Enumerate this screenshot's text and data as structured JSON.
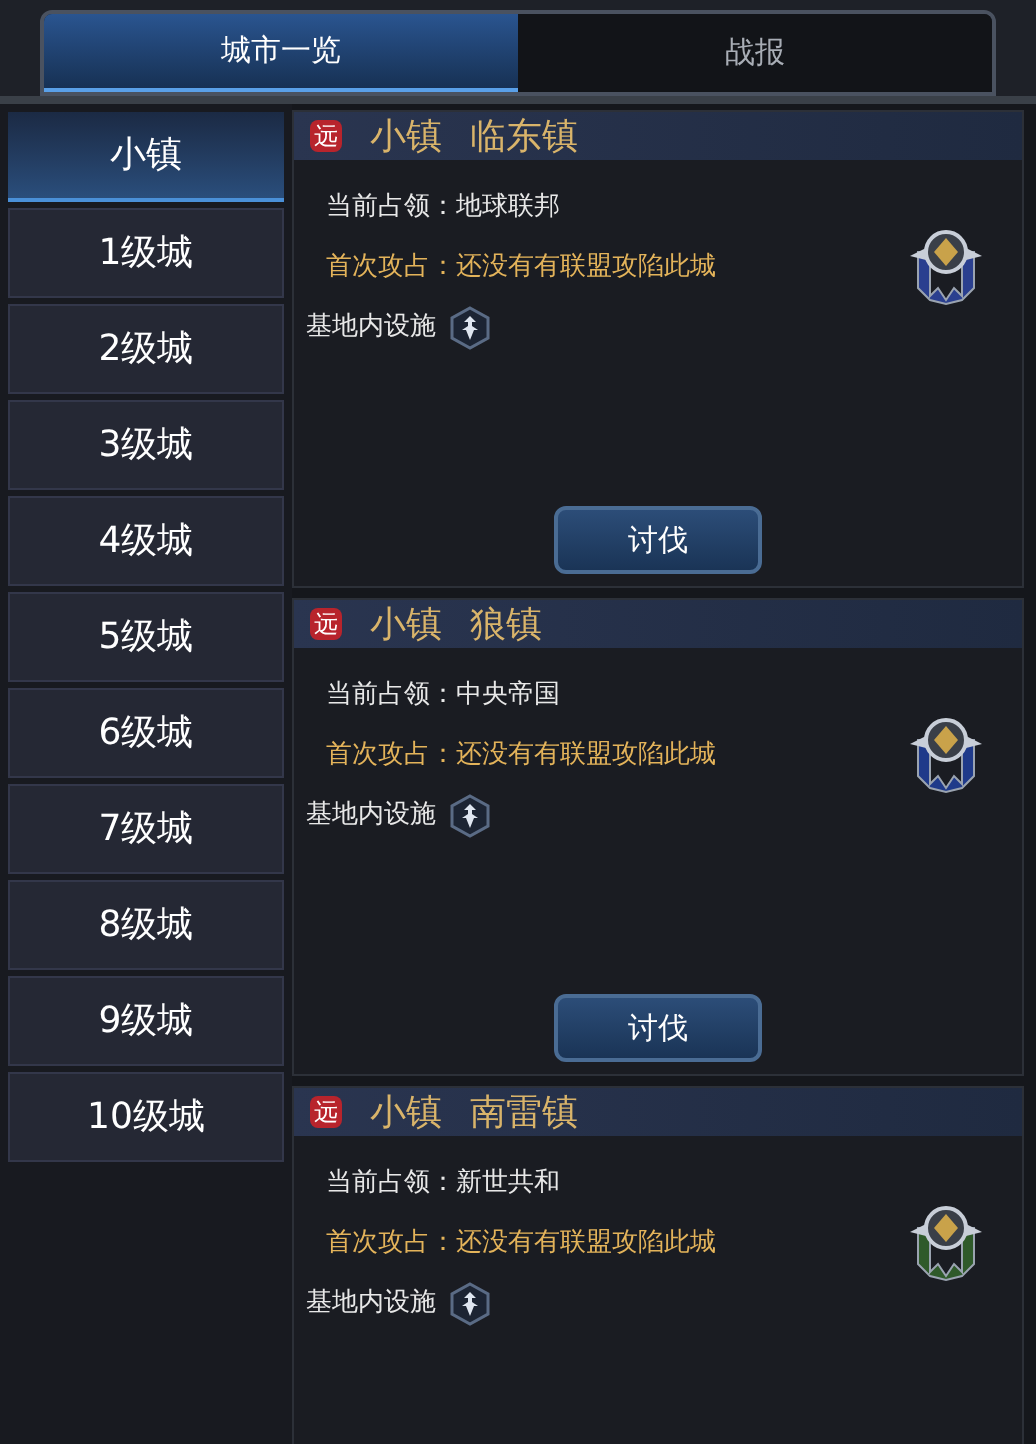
{
  "tabs": [
    {
      "label": "城市一览",
      "selected": true
    },
    {
      "label": "战报",
      "selected": false
    }
  ],
  "sidebar": {
    "items": [
      {
        "label": "小镇",
        "selected": true
      },
      {
        "label": "1级城",
        "selected": false
      },
      {
        "label": "2级城",
        "selected": false
      },
      {
        "label": "3级城",
        "selected": false
      },
      {
        "label": "4级城",
        "selected": false
      },
      {
        "label": "5级城",
        "selected": false
      },
      {
        "label": "6级城",
        "selected": false
      },
      {
        "label": "7级城",
        "selected": false
      },
      {
        "label": "8级城",
        "selected": false
      },
      {
        "label": "9级城",
        "selected": false
      },
      {
        "label": "10级城",
        "selected": false
      }
    ]
  },
  "cities": [
    {
      "badge": "远",
      "type": "小镇",
      "name": "临东镇",
      "occupant_label": "当前占领：",
      "occupant": "地球联邦",
      "first_capture": "首次攻占：还没有有联盟攻陷此城",
      "facilities_label": "基地内设施",
      "color": "#2a3f8f",
      "button": "讨伐"
    },
    {
      "badge": "远",
      "type": "小镇",
      "name": "狼镇",
      "occupant_label": "当前占领：",
      "occupant": "中央帝国",
      "first_capture": "首次攻占：还没有有联盟攻陷此城",
      "facilities_label": "基地内设施",
      "color": "#1f3a8a",
      "button": "讨伐"
    },
    {
      "badge": "远",
      "type": "小镇",
      "name": "南雷镇",
      "occupant_label": "当前占领：",
      "occupant": "新世共和",
      "first_capture": "首次攻占：还没有有联盟攻陷此城",
      "facilities_label": "基地内设施",
      "color": "#2f5a2a"
    }
  ]
}
